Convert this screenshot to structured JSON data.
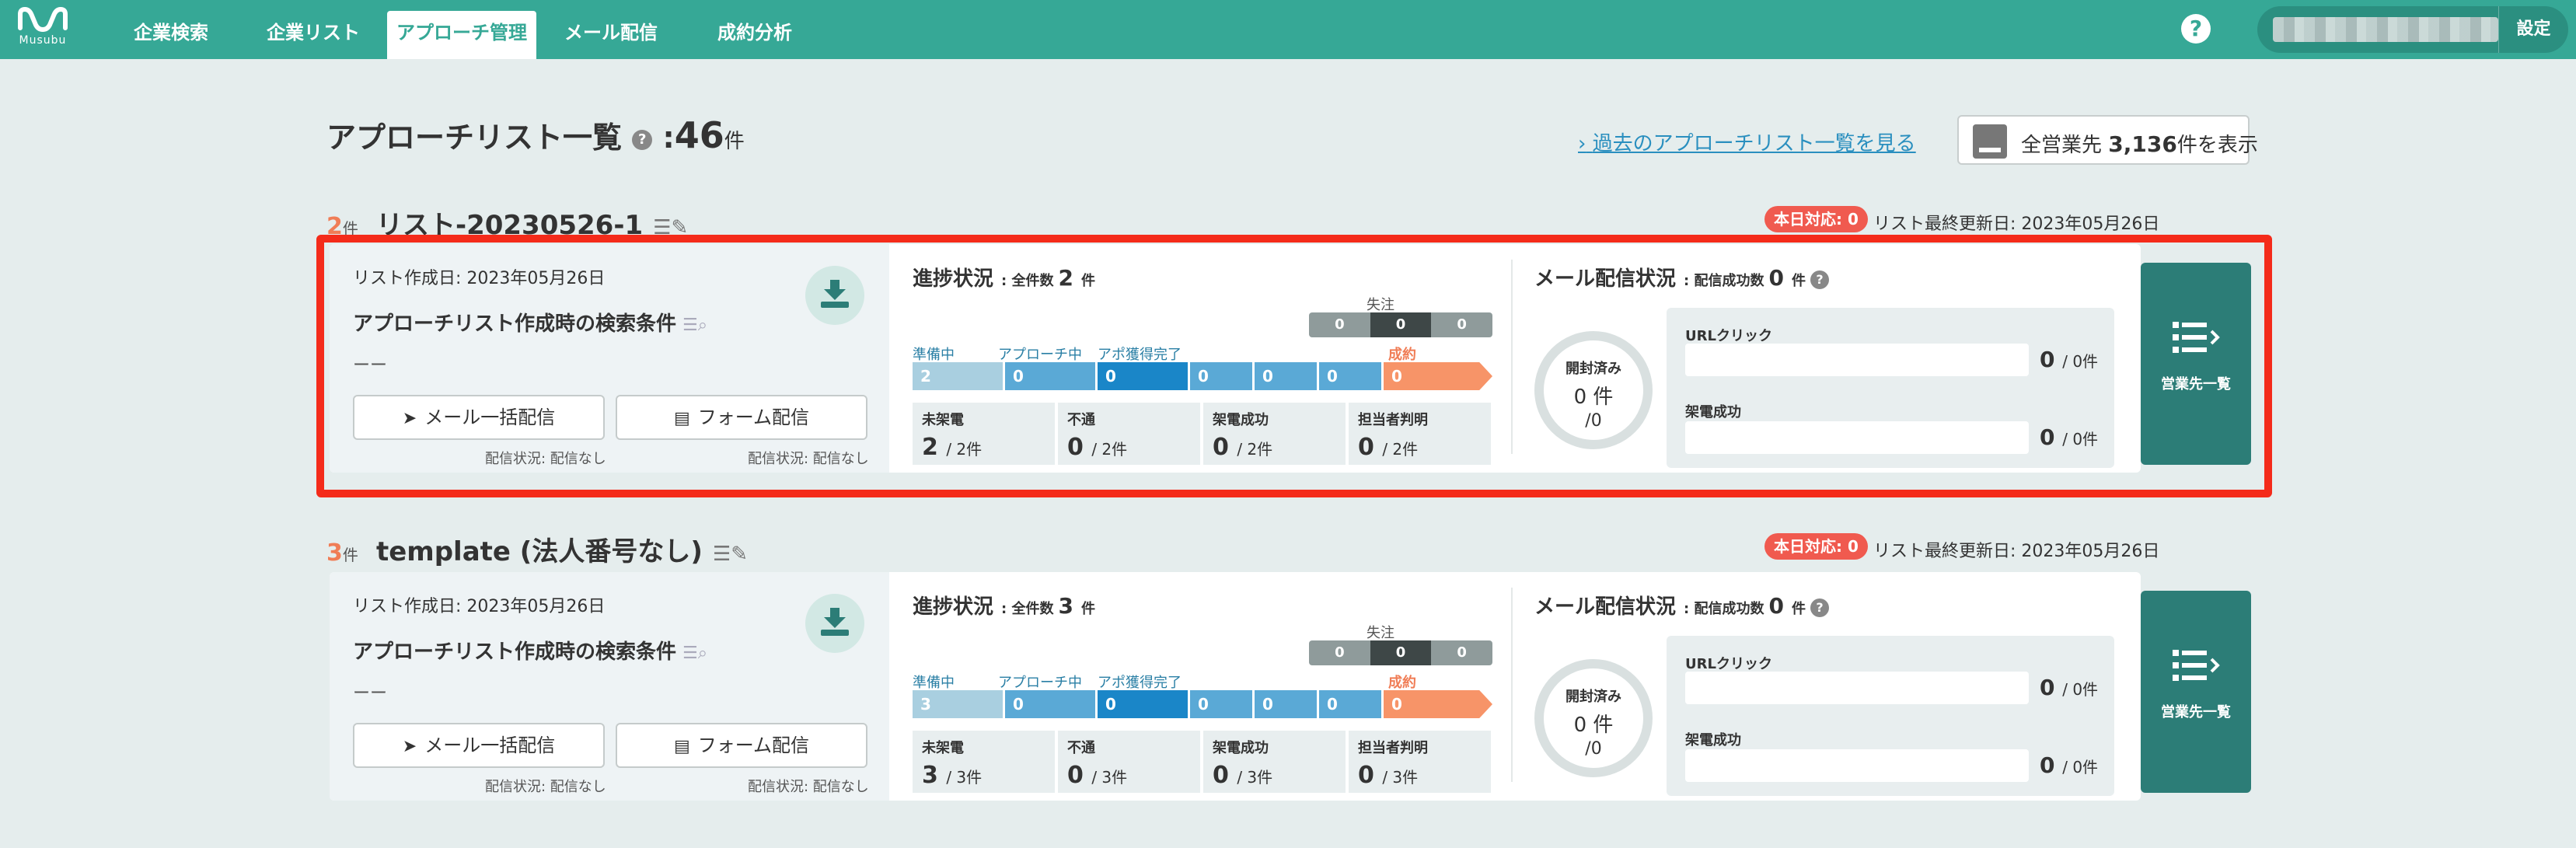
{
  "nav": {
    "logo_text": "Musubu",
    "tabs": [
      "企業検索",
      "企業リスト",
      "アプローチ管理",
      "メール配信",
      "成約分析"
    ],
    "active_tab": "アプローチ管理",
    "settings_label": "設定"
  },
  "header": {
    "title": "アプローチリスト一覧",
    "help": "?",
    "count_prefix": ":",
    "count": "46",
    "count_unit": "件",
    "past_link": "過去のアプローチリスト一覧を見る",
    "all_prefix": "全営業先",
    "all_count": "3,136",
    "all_suffix": "件を表示"
  },
  "lists": [
    {
      "count": "2",
      "count_unit": "件",
      "name": "リスト-20230526-1",
      "today_badge": "本日対応: 0",
      "last_updated": "リスト最終更新日: 2023年05月26日",
      "created": "リスト作成日: 2023年05月26日",
      "condition_title": "アプローチリスト作成時の検索条件",
      "condition_value": "ーー",
      "mail_button": "メール一括配信",
      "form_button": "フォーム配信",
      "mail_status": "配信状況: 配信なし",
      "form_status": "配信状況: 配信なし",
      "progress": {
        "title": "進捗状況",
        "total_label": ": 全件数",
        "total": "2",
        "total_unit": "件",
        "lost_label": "失注",
        "lost": [
          "0",
          "0",
          "0"
        ],
        "stage_labels": [
          "準備中",
          "アプローチ中",
          "アポ獲得完了",
          "成約"
        ],
        "stages": [
          "2",
          "0",
          "0",
          "0",
          "0",
          "0",
          "0"
        ],
        "stats": [
          {
            "label": "未架電",
            "value": "2",
            "denom": "/ 2件"
          },
          {
            "label": "不通",
            "value": "0",
            "denom": "/ 2件"
          },
          {
            "label": "架電成功",
            "value": "0",
            "denom": "/ 2件"
          },
          {
            "label": "担当者判明",
            "value": "0",
            "denom": "/ 2件"
          }
        ]
      },
      "mail": {
        "title": "メール配信状況",
        "success_label": ": 配信成功数",
        "success": "0",
        "success_unit": "件",
        "help": "?",
        "opened_label": "開封済み",
        "opened": "0 件",
        "opened_denom": "/0",
        "url_click_label": "URLクリック",
        "url_click": "0",
        "url_click_denom": "/ 0件",
        "call_label": "架電成功",
        "call": "0",
        "call_denom": "/ 0件"
      },
      "sales_button": "営業先一覧"
    },
    {
      "count": "3",
      "count_unit": "件",
      "name": "template (法人番号なし)",
      "today_badge": "本日対応: 0",
      "last_updated": "リスト最終更新日: 2023年05月26日",
      "created": "リスト作成日: 2023年05月26日",
      "condition_title": "アプローチリスト作成時の検索条件",
      "condition_value": "ーー",
      "mail_button": "メール一括配信",
      "form_button": "フォーム配信",
      "mail_status": "配信状況: 配信なし",
      "form_status": "配信状況: 配信なし",
      "progress": {
        "title": "進捗状況",
        "total_label": ": 全件数",
        "total": "3",
        "total_unit": "件",
        "lost_label": "失注",
        "lost": [
          "0",
          "0",
          "0"
        ],
        "stage_labels": [
          "準備中",
          "アプローチ中",
          "アポ獲得完了",
          "成約"
        ],
        "stages": [
          "3",
          "0",
          "0",
          "0",
          "0",
          "0",
          "0"
        ],
        "stats": [
          {
            "label": "未架電",
            "value": "3",
            "denom": "/ 3件"
          },
          {
            "label": "不通",
            "value": "0",
            "denom": "/ 3件"
          },
          {
            "label": "架電成功",
            "value": "0",
            "denom": "/ 3件"
          },
          {
            "label": "担当者判明",
            "value": "0",
            "denom": "/ 3件"
          }
        ]
      },
      "mail": {
        "title": "メール配信状況",
        "success_label": ": 配信成功数",
        "success": "0",
        "success_unit": "件",
        "help": "?",
        "opened_label": "開封済み",
        "opened": "0 件",
        "opened_denom": "/0",
        "url_click_label": "URLクリック",
        "url_click": "0",
        "url_click_denom": "/ 0件",
        "call_label": "架電成功",
        "call": "0",
        "call_denom": "/ 0件"
      },
      "sales_button": "営業先一覧"
    }
  ],
  "colors": {
    "nav": "#36a896",
    "accent_orange": "#f07d56",
    "badge_red": "#f05a4f",
    "highlight": "#f42b1a",
    "sales_button": "#2c7d77",
    "stage_prep": "#a9cfe0",
    "stage_approach": "#5aa9d6",
    "stage_appo": "#1a86c8"
  }
}
